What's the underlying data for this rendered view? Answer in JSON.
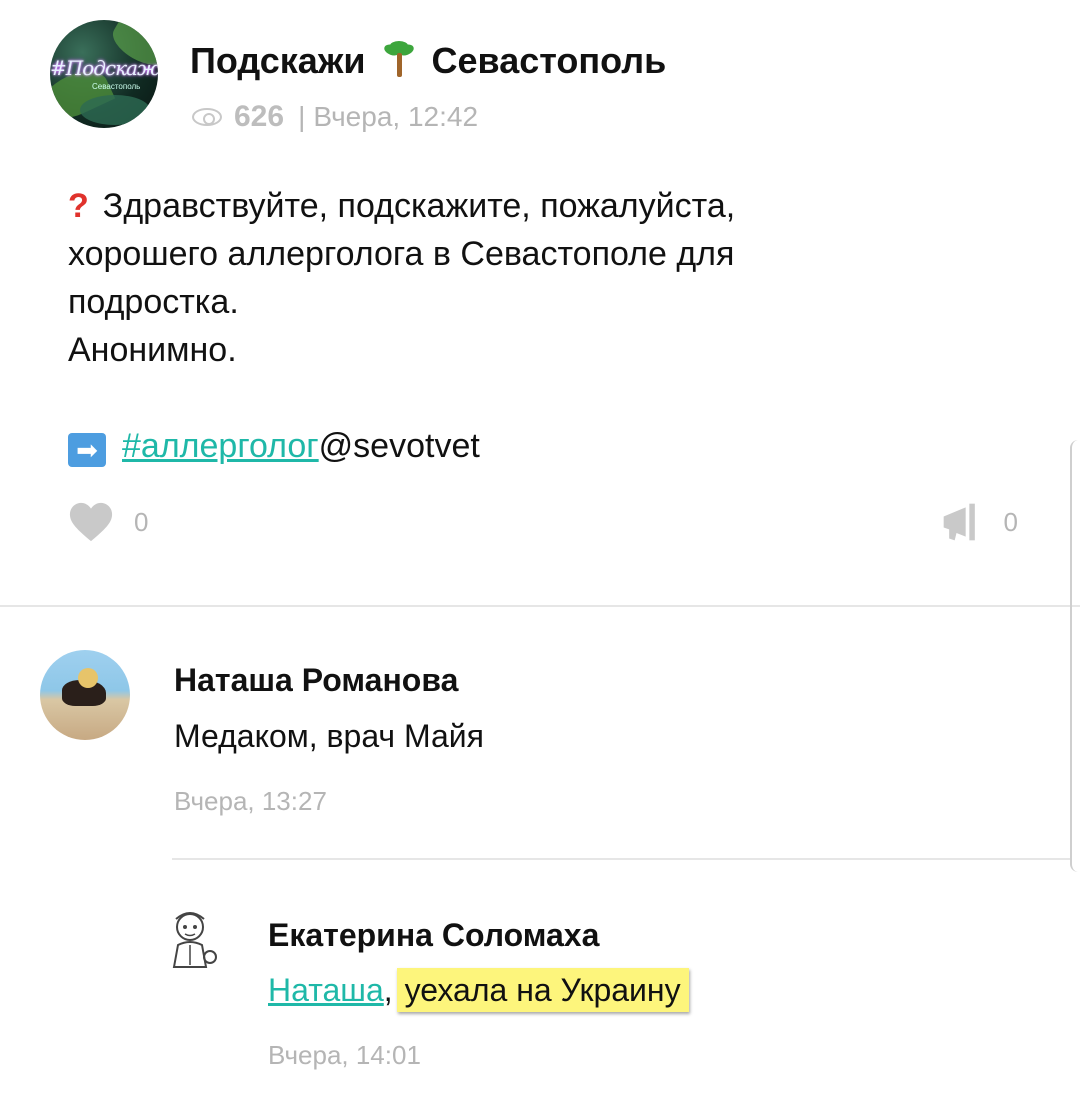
{
  "post": {
    "group_name_part1": "Подскажи",
    "group_name_part2": "Севастополь",
    "avatar_text": "#Подскажи",
    "avatar_subtext": "Севастополь",
    "views": "626",
    "meta_separator": "|",
    "timestamp": "Вчера, 12:42",
    "text_line1": "Здравствуйте, подскажите, пожалуйста,",
    "text_line2": "хорошего аллерголога в Севастополе для",
    "text_line3": "подростка.",
    "text_line4": "Анонимно.",
    "hashtag": "#аллерголог",
    "mention": "@sevotvet",
    "likes": "0",
    "shares": "0"
  },
  "comments": [
    {
      "author": "Наташа Романова",
      "text": "Медаком, врач Майя",
      "time": "Вчера, 13:27"
    },
    {
      "author": "Екатерина Соломаха",
      "reply_to": "Наташа",
      "reply_separator": ",",
      "text": "уехала на Украину",
      "time": "Вчера, 14:01"
    }
  ],
  "colors": {
    "link": "#1fb8a8",
    "highlight": "#fdf57c",
    "muted": "#b5b5b5"
  },
  "icons": [
    "palm-tree-icon",
    "eye-icon",
    "question-mark-icon",
    "right-arrow-icon",
    "heart-icon",
    "megaphone-icon"
  ]
}
